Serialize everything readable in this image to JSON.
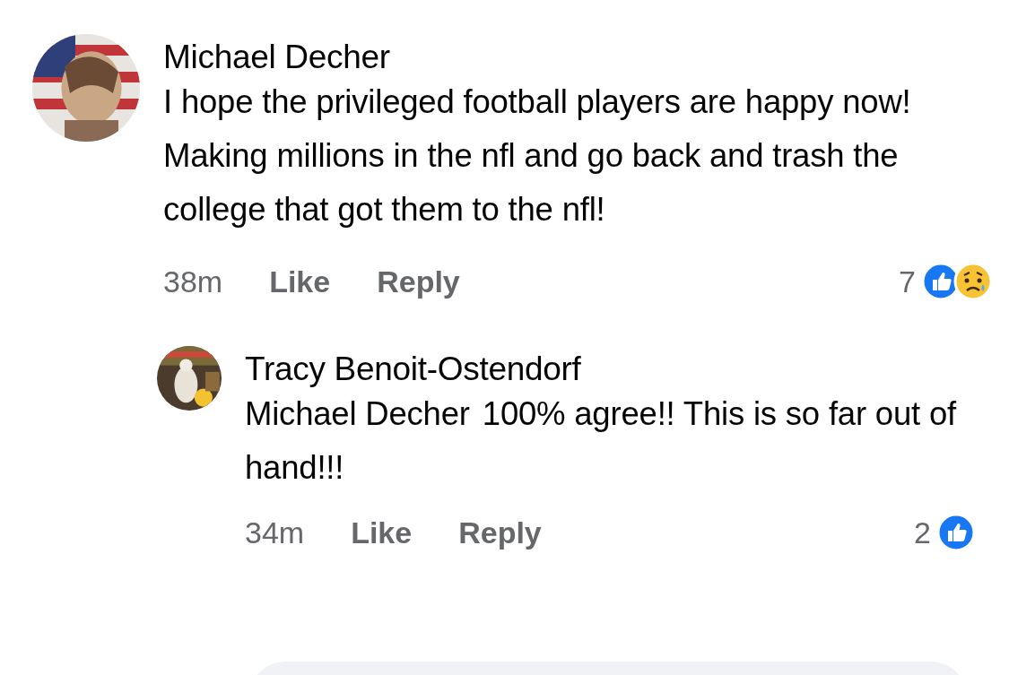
{
  "comments": [
    {
      "author": "Michael Decher",
      "avatar": {
        "kind": "picture"
      },
      "text": "I hope the privileged football players are happy now! Making millions in the nfl and go back and trash the college that got them to the nfl!",
      "time": "38m",
      "actions": [
        "Like",
        "Reply"
      ],
      "reaction_count": "7",
      "reactions": [
        {
          "kind": "like"
        },
        {
          "kind": "sad"
        }
      ],
      "replies": [
        {
          "author": "Tracy Benoit-Ostendorf",
          "avatar": {
            "kind": "picture"
          },
          "mention": "Michael Decher",
          "text": "100% agree!! This is so far out of hand!!!",
          "time": "34m",
          "actions": [
            "Like",
            "Reply"
          ],
          "reaction_count": "2",
          "reactions": [
            {
              "kind": "like"
            }
          ]
        }
      ]
    }
  ],
  "composer": {
    "kind": "field"
  }
}
